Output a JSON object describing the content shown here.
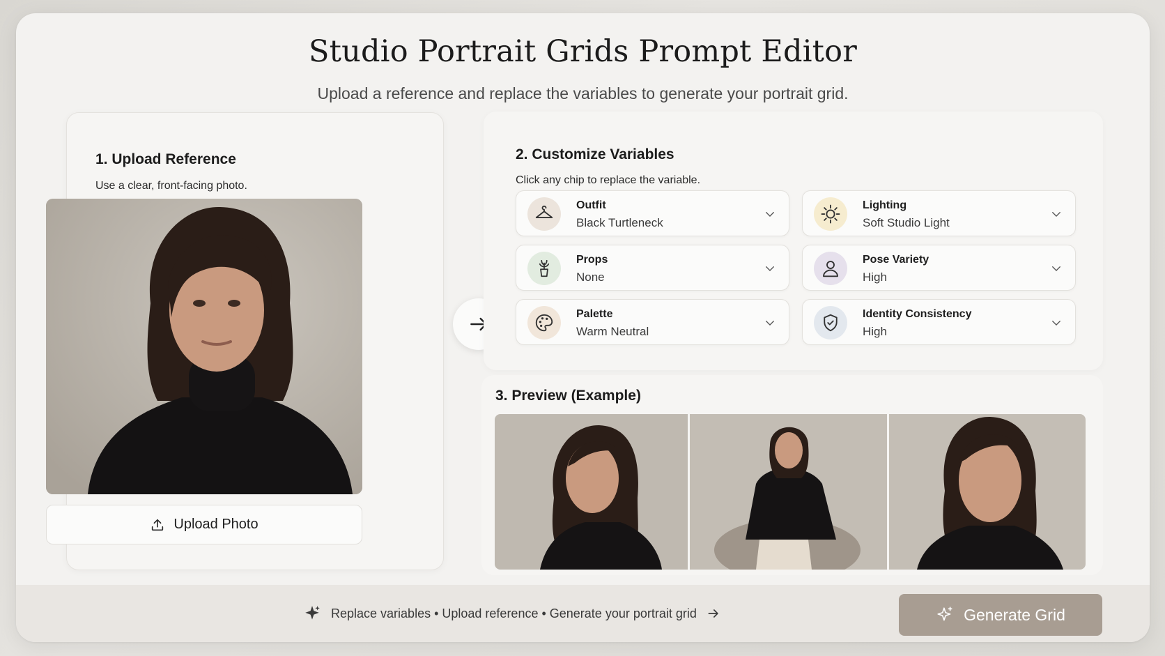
{
  "header": {
    "title": "Studio Portrait Grids Prompt Editor",
    "subtitle": "Upload a reference and replace the variables to generate your portrait grid."
  },
  "upload": {
    "heading": "1. Upload Reference",
    "hint": "Use a clear, front-facing photo.",
    "button_label": "Upload Photo"
  },
  "variables": {
    "heading": "2. Customize Variables",
    "hint": "Click any chip to replace the variable.",
    "chips": [
      {
        "label": "Outfit",
        "value": "Black Turtleneck",
        "icon": "hanger-icon",
        "icon_bg": "#ece4dc"
      },
      {
        "label": "Lighting",
        "value": "Soft Studio Light",
        "icon": "sun-icon",
        "icon_bg": "#f6eccf"
      },
      {
        "label": "Props",
        "value": "None",
        "icon": "plant-icon",
        "icon_bg": "#e2ece0"
      },
      {
        "label": "Pose Variety",
        "value": "High",
        "icon": "person-icon",
        "icon_bg": "#e6e0ec"
      },
      {
        "label": "Palette",
        "value": "Warm Neutral",
        "icon": "palette-icon",
        "icon_bg": "#f1e6da"
      },
      {
        "label": "Identity Consistency",
        "value": "High",
        "icon": "shield-icon",
        "icon_bg": "#e3e8ee"
      }
    ]
  },
  "preview": {
    "heading": "3. Preview (Example)"
  },
  "footer": {
    "info_text": "Replace variables • Upload reference • Generate your portrait grid",
    "generate_label": "Generate Grid"
  },
  "colors": {
    "accent": "#a89d92",
    "background": "#f3f2f0"
  }
}
